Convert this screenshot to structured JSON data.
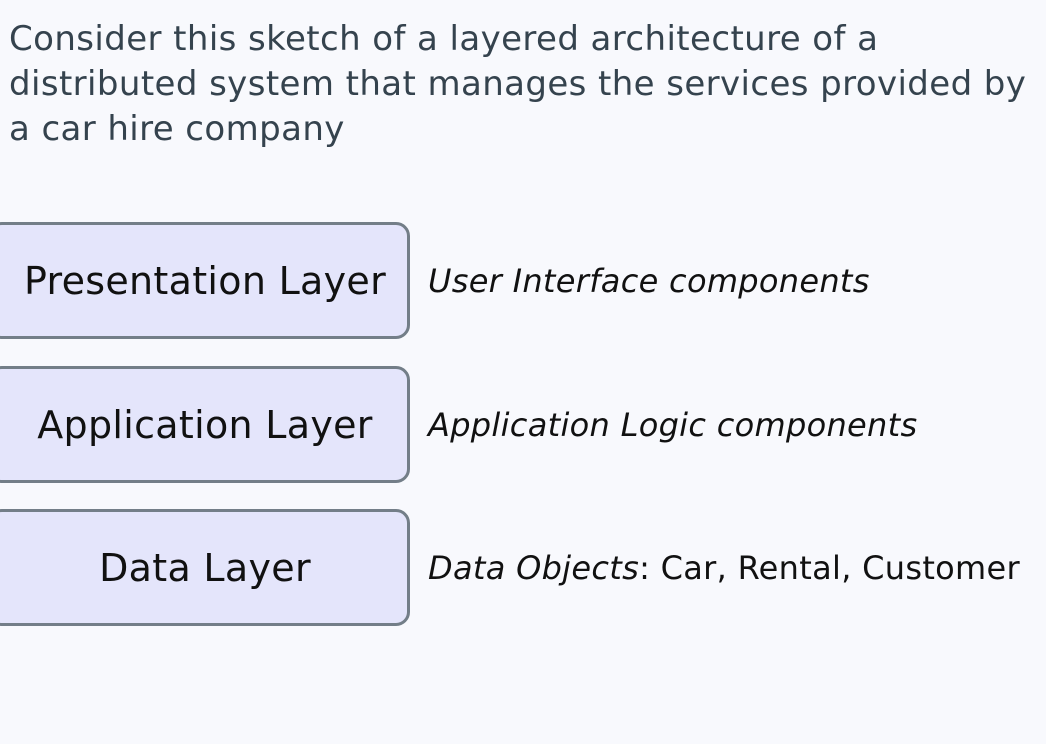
{
  "intro_text": "Consider this sketch of a layered architecture of a distributed system that manages the services provided by a car hire company",
  "layers": [
    {
      "name": "Presentation Layer",
      "description_italic": "User Interface components",
      "description_plain": ""
    },
    {
      "name": "Application Layer",
      "description_italic": "Application Logic components",
      "description_plain": ""
    },
    {
      "name": "Data Layer",
      "description_italic": "Data Objects",
      "description_plain": ": Car, Rental, Customer"
    }
  ],
  "colors": {
    "background": "#f8f9fd",
    "box_fill": "#e4e5fb",
    "box_border": "#737e88",
    "intro_text": "#35434e",
    "layer_text": "#111111"
  }
}
